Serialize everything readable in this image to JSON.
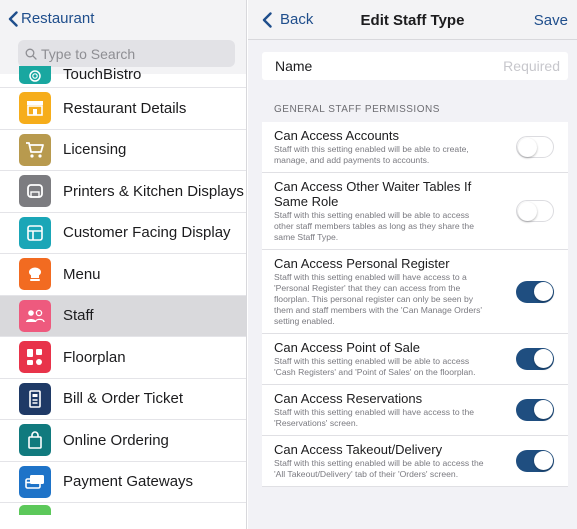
{
  "sidebar": {
    "back_label": "Restaurant",
    "search_placeholder": "Type to Search",
    "items": [
      {
        "label": "TouchBistro",
        "color": "#19a7a0",
        "icon": "touchbistro-logo-icon"
      },
      {
        "label": "Restaurant Details",
        "color": "#f6ad1b",
        "icon": "storefront-icon"
      },
      {
        "label": "Licensing",
        "color": "#b89a4e",
        "icon": "shopping-cart-icon"
      },
      {
        "label": "Printers & Kitchen Displays",
        "color": "#7c7c80",
        "icon": "printer-icon"
      },
      {
        "label": "Customer Facing Display",
        "color": "#1aa6b7",
        "icon": "display-layout-icon"
      },
      {
        "label": "Menu",
        "color": "#f26b21",
        "icon": "chef-hat-icon"
      },
      {
        "label": "Staff",
        "color": "#ee5a7e",
        "icon": "people-icon"
      },
      {
        "label": "Floorplan",
        "color": "#e8334a",
        "icon": "floorplan-tables-icon"
      },
      {
        "label": "Bill & Order Ticket",
        "color": "#1f3a66",
        "icon": "receipt-icon"
      },
      {
        "label": "Online Ordering",
        "color": "#117a7e",
        "icon": "shopping-bag-icon"
      },
      {
        "label": "Payment Gateways",
        "color": "#1e73c8",
        "icon": "credit-card-icon"
      }
    ],
    "next_item_color": "#5cc85a"
  },
  "nav": {
    "back_label": "Back",
    "title": "Edit Staff Type",
    "save_label": "Save"
  },
  "name_field": {
    "label": "Name",
    "placeholder": "Required",
    "value": ""
  },
  "section_title": "GENERAL STAFF PERMISSIONS",
  "permissions": [
    {
      "title": "Can Access Accounts",
      "description": "Staff with this setting enabled will be able to create, manage, and add payments to accounts.",
      "enabled": false
    },
    {
      "title": "Can Access Other Waiter Tables If Same Role",
      "description": "Staff with this setting enabled will be able to access other staff members tables as long as they share the same Staff Type.",
      "enabled": false
    },
    {
      "title": "Can Access Personal Register",
      "description": "Staff with this setting enabled will have access to a 'Personal Register' that they can access from the floorplan. This personal register can only be seen by them and staff members with the 'Can Manage Orders' setting enabled.",
      "enabled": true
    },
    {
      "title": "Can Access Point of Sale",
      "description": "Staff with this setting enabled will be able to access 'Cash Registers' and 'Point of Sales' on the floorplan.",
      "enabled": true
    },
    {
      "title": "Can Access Reservations",
      "description": "Staff with this setting enabled will have access to the 'Reservations' screen.",
      "enabled": true
    },
    {
      "title": "Can Access Takeout/Delivery",
      "description": "Staff with this setting enabled will be able to access the 'All Takeout/Delivery' tab of their 'Orders' screen.",
      "enabled": true
    }
  ],
  "colors": {
    "accent": "#1f4e8c",
    "toggle_on": "#1f4e80",
    "active_row": "#d9d9dc"
  }
}
